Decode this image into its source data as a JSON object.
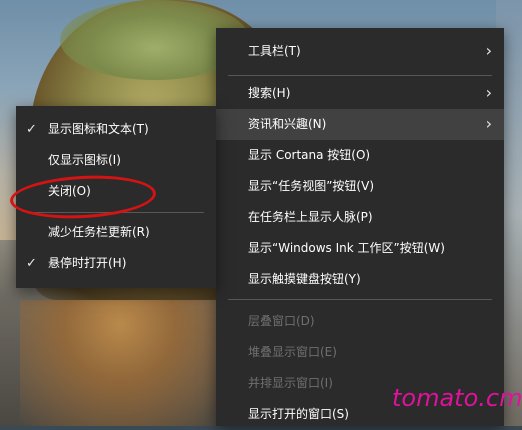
{
  "main_menu": {
    "items": [
      {
        "label": "工具栏(T)",
        "submenu": true
      },
      {
        "label": "搜索(H)",
        "submenu": true
      },
      {
        "label": "资讯和兴趣(N)",
        "submenu": true,
        "highlighted": true
      },
      {
        "label": "显示 Cortana 按钮(O)"
      },
      {
        "label": "显示“任务视图”按钮(V)"
      },
      {
        "label": "在任务栏上显示人脉(P)"
      },
      {
        "label": "显示“Windows Ink 工作区”按钮(W)"
      },
      {
        "label": "显示触摸键盘按钮(Y)"
      },
      {
        "label": "层叠窗口(D)",
        "disabled": true
      },
      {
        "label": "堆叠显示窗口(E)",
        "disabled": true
      },
      {
        "label": "并排显示窗口(I)",
        "disabled": true
      },
      {
        "label": "显示打开的窗口(S)"
      }
    ]
  },
  "sub_menu": {
    "items": [
      {
        "label": "显示图标和文本(T)",
        "checked": true
      },
      {
        "label": "仅显示图标(I)"
      },
      {
        "label": "关闭(O)",
        "annotated": true
      },
      {
        "label": "减少任务栏更新(R)"
      },
      {
        "label": "悬停时打开(H)",
        "checked": true
      }
    ]
  },
  "glyphs": {
    "chevron": "›",
    "check": "✓"
  },
  "colors": {
    "menu_bg": "#2b2b2b",
    "highlight": "#414141",
    "annotation": "#d41414",
    "watermark": "#e0119a"
  },
  "watermark": "tomato.cm"
}
